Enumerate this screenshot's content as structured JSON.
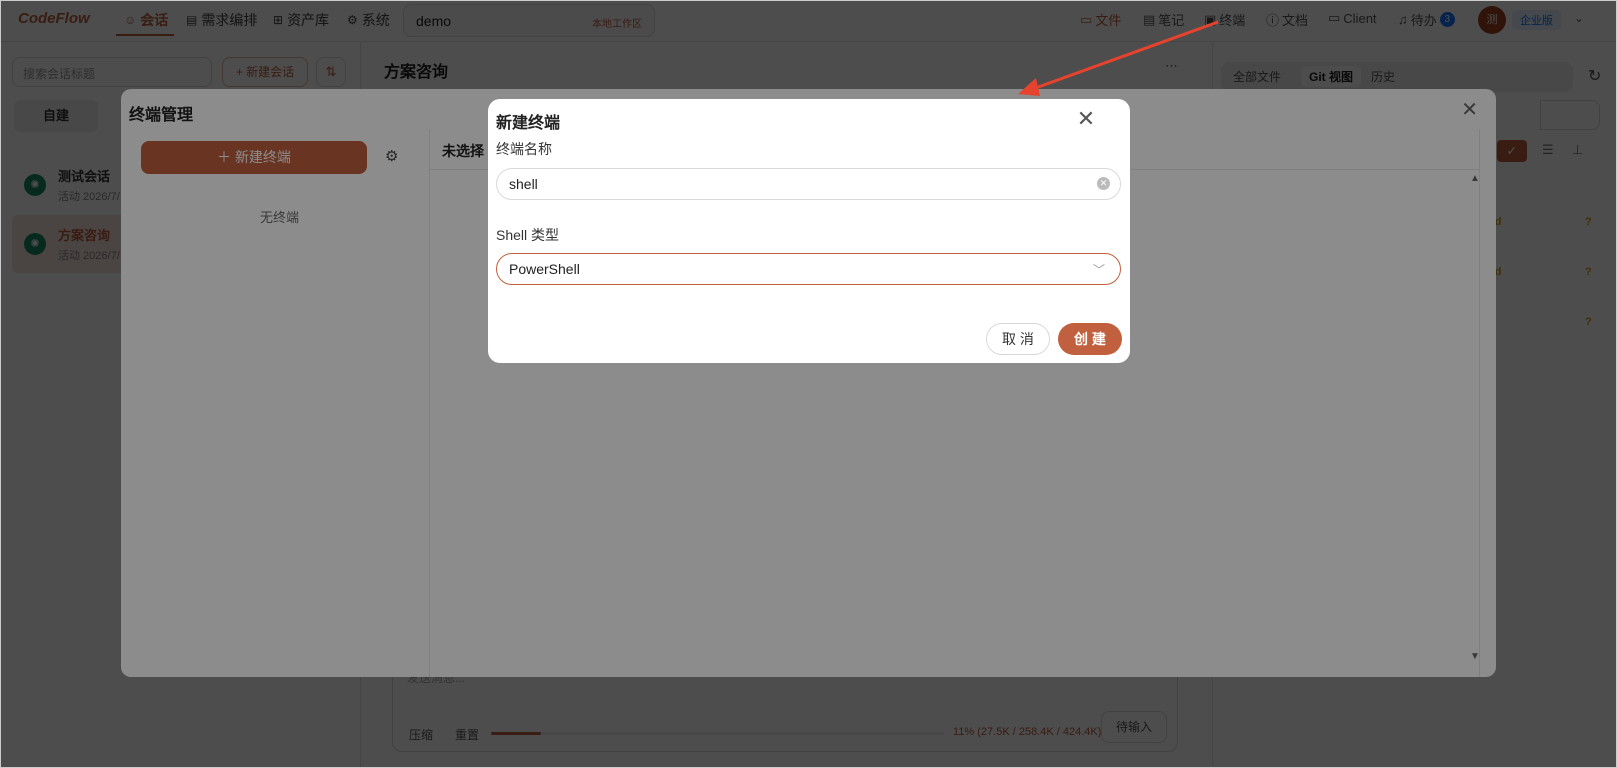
{
  "topbar": {
    "logo": "CodeFlow",
    "nav": [
      {
        "icon": "chat-icon",
        "label": "会话"
      },
      {
        "icon": "doc-icon",
        "label": "需求编排"
      },
      {
        "icon": "assets-icon",
        "label": "资产库"
      },
      {
        "icon": "gear-icon",
        "label": "系统"
      }
    ],
    "workspace_name": "demo",
    "workspace_tag": "本地工作区",
    "right": [
      {
        "icon": "folder-icon",
        "label": "文件"
      },
      {
        "icon": "note-icon",
        "label": "笔记"
      },
      {
        "icon": "terminal-icon",
        "label": "终端"
      },
      {
        "icon": "help-icon",
        "label": "文档"
      },
      {
        "icon": "monitor-icon",
        "label": "Client"
      },
      {
        "icon": "bell-icon",
        "label": "待办"
      }
    ],
    "todo_count": "3",
    "avatar_text": "测",
    "edition": "企业版"
  },
  "left": {
    "search_placeholder": "搜索会话标题",
    "new_conversation": "+ 新建会话",
    "segment": "自建",
    "conversations": [
      {
        "title": "测试会话",
        "sub": "活动 2026/7/"
      },
      {
        "title": "方案咨询",
        "sub": "活动 2026/7/"
      }
    ]
  },
  "center": {
    "title": "方案咨询",
    "input_placeholder": "发送消息...",
    "btn_compress": "压缩",
    "btn_reset": "重置",
    "context_progress": 0.11,
    "context_stat": "11% (27.5K / 258.4K / 424.4K)",
    "wait_input": "待输入"
  },
  "right": {
    "tabs": [
      "全部文件",
      "Git 视图",
      "历史"
    ],
    "active_tab": "Git 视图",
    "lines": [
      {
        "text": "nd",
        "q": "?"
      },
      {
        "text": "nd",
        "q": "?"
      },
      {
        "text": "",
        "q": "?"
      }
    ]
  },
  "terminal_manager": {
    "title": "终端管理",
    "new_terminal": "新建终端",
    "empty": "无终端",
    "unselected": "未选择"
  },
  "dialog": {
    "title": "新建终端",
    "name_label": "终端名称",
    "name_value": "shell",
    "shell_label": "Shell 类型",
    "shell_value": "PowerShell",
    "cancel": "取 消",
    "create": "创 建"
  },
  "colors": {
    "accent": "#c0603f",
    "annotation_arrow": "#e5432e"
  }
}
